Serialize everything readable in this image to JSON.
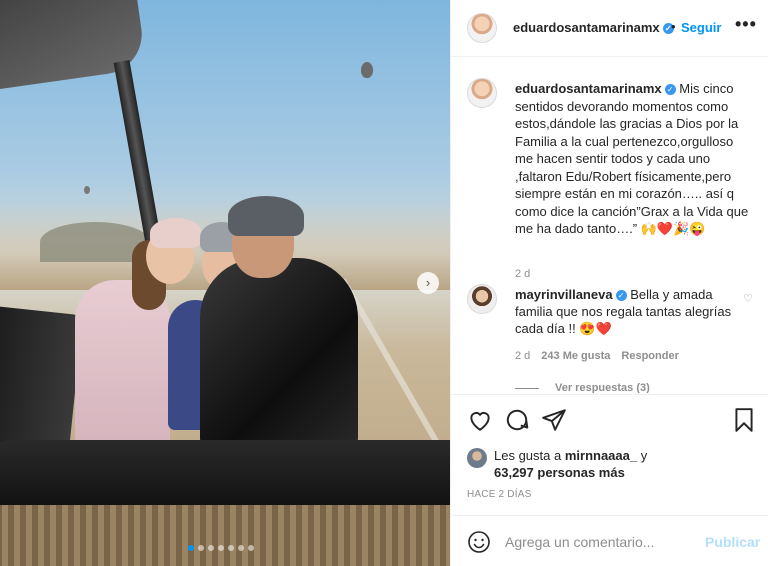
{
  "post": {
    "carousel": {
      "slide_count": 7,
      "active_slide": 0
    }
  },
  "header": {
    "username": "eduardosantamarinamx",
    "follow_label": "Seguir",
    "separator": "•",
    "more_label": "•••"
  },
  "caption": {
    "username": "eduardosantamarinamx",
    "text": "Mis cinco sentidos devorando momentos como estos,dándole las gracias a Dios por la Familia a la cual pertenezco,orgulloso me hacen sentir todos y cada uno ,faltaron Edu/Robert físicamente,pero siempre están en mi corazón….. así q como dice la canción”Grax a la Vida que me ha dado tanto….” 🙌❤️🎉😜",
    "time": "2 d"
  },
  "comment": {
    "username": "mayrinvillaneva",
    "text": "Bella y amada familia que nos regala tantas alegrías cada día !! 😍❤️",
    "time": "2 d",
    "likes": "243 Me gusta",
    "reply_label": "Responder",
    "view_replies": "Ver respuestas (3)"
  },
  "likes": {
    "prefix": "Les gusta a",
    "user": "mirnnaaaa_",
    "conj": "y",
    "count": "63,297 personas más"
  },
  "date": "HACE 2 DÍAS",
  "add_comment": {
    "placeholder": "Agrega un comentario...",
    "post_label": "Publicar"
  },
  "colors": {
    "accent": "#0095f6",
    "verified": "#3897f0",
    "muted": "#8e8e8e",
    "post_disabled": "#b2dffc"
  }
}
